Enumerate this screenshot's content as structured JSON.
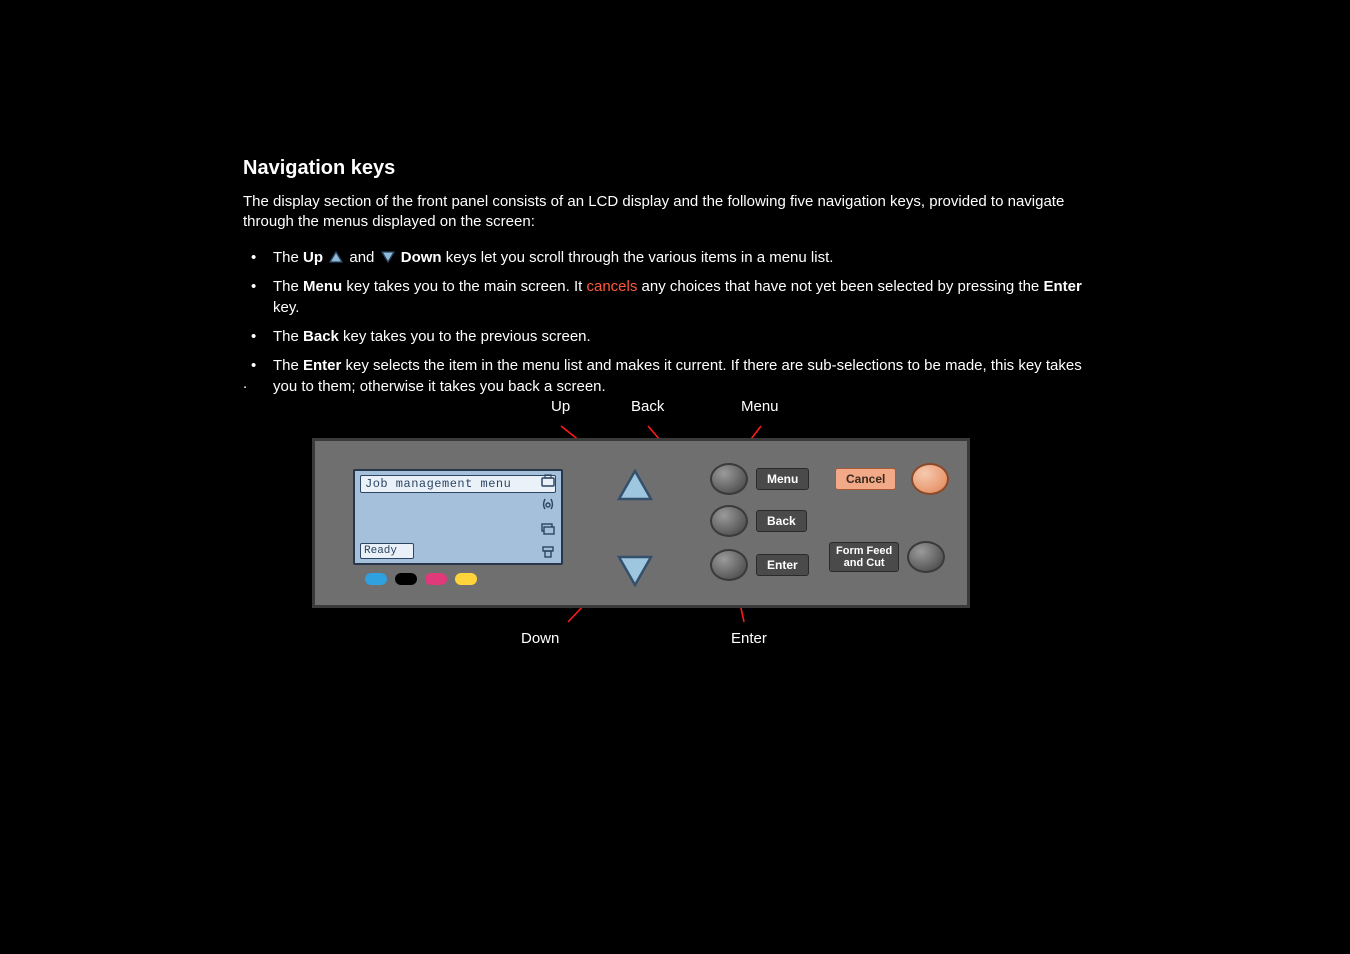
{
  "heading": "Navigation keys",
  "intro": "The display section of the front panel consists of an LCD display and the following five navigation keys, provided to navigate through the menus displayed on the screen:",
  "bullet1": {
    "pre": "The ",
    "up": "Up",
    "and": " and ",
    "down": "Down",
    "post": " keys let you scroll through the various items in a menu list."
  },
  "bullet2": {
    "pre": "The ",
    "menu": "Menu",
    "mid1": " key takes you to the main screen. It ",
    "cancels": "cancels",
    "mid2": " any choices that have not yet been selected by pressing the ",
    "enter": "Enter",
    "post": " key."
  },
  "bullet3": {
    "pre": "The ",
    "back": "Back",
    "post": " key takes you to the previous screen."
  },
  "bullet4": {
    "pre": "The ",
    "enter": "Enter",
    "post": " key selects the item in the menu list and makes it current. If there are sub-selections to be made, this key takes you to them; otherwise it takes you back a screen."
  },
  "labels": {
    "up": "Up",
    "back": "Back",
    "menu": "Menu",
    "down": "Down",
    "enter": "Enter"
  },
  "panel": {
    "lcd_row1": "Job management menu",
    "lcd_status": "Ready",
    "btn_menu": "Menu",
    "btn_back": "Back",
    "btn_enter": "Enter",
    "btn_cancel": "Cancel",
    "btn_formfeed_l1": "Form Feed",
    "btn_formfeed_l2": "and Cut"
  },
  "dotchar": "."
}
